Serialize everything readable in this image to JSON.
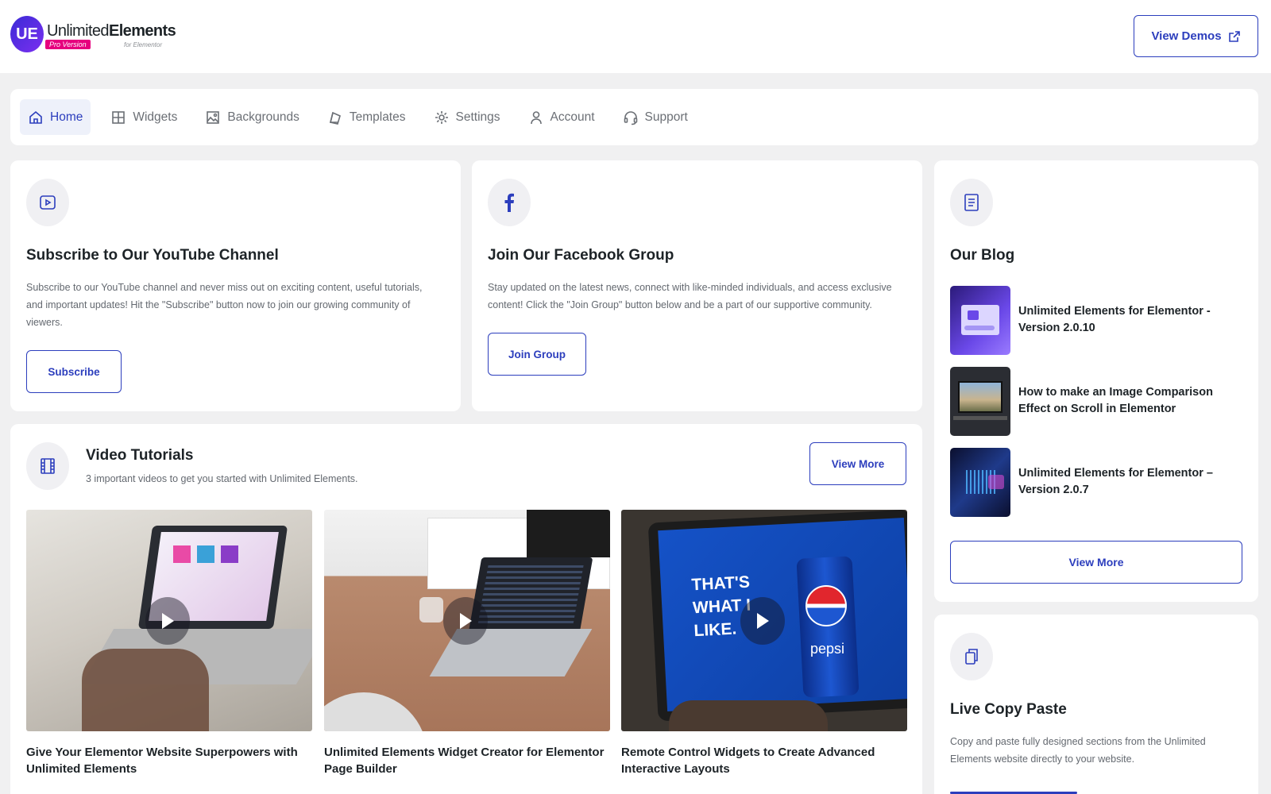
{
  "brand": {
    "mark": "UE",
    "name_thin": "Unlimited",
    "name_bold": "Elements",
    "badge": "Pro Version",
    "tagline": "for Elementor"
  },
  "header": {
    "view_demos_label": "View Demos"
  },
  "nav": {
    "items": [
      {
        "label": "Home",
        "icon": "home-icon"
      },
      {
        "label": "Widgets",
        "icon": "grid-icon"
      },
      {
        "label": "Backgrounds",
        "icon": "image-icon"
      },
      {
        "label": "Templates",
        "icon": "templates-icon"
      },
      {
        "label": "Settings",
        "icon": "gear-icon"
      },
      {
        "label": "Account",
        "icon": "user-icon"
      },
      {
        "label": "Support",
        "icon": "headset-icon"
      }
    ],
    "active": "Home"
  },
  "youtube": {
    "title": "Subscribe to Our YouTube Channel",
    "description": "Subscribe to our YouTube channel and never miss out on exciting content, useful tutorials, and important updates! Hit the \"Subscribe\" button now to join our growing community of viewers.",
    "button_label": "Subscribe"
  },
  "facebook": {
    "title": "Join Our Facebook Group",
    "description": "Stay updated on the latest news, connect with like-minded individuals, and access exclusive content! Click the \"Join Group\" button below and be a part of our supportive community.",
    "button_label": "Join Group"
  },
  "blog": {
    "title": "Our Blog",
    "posts": [
      {
        "title": "Unlimited Elements for Elementor - Version 2.0.10"
      },
      {
        "title": "How to make an Image Comparison Effect on Scroll in Elementor"
      },
      {
        "title": "Unlimited Elements for Elementor – Version 2.0.7"
      }
    ],
    "view_more_label": "View More"
  },
  "tutorials": {
    "title": "Video Tutorials",
    "subtitle": "3 important videos to get you started with Unlimited Elements.",
    "view_more_label": "View More",
    "videos": [
      {
        "title": "Give Your Elementor Website Superpowers with Unlimited Elements"
      },
      {
        "title": "Unlimited Elements Widget Creator for Elementor Page Builder"
      },
      {
        "title": "Remote Control Widgets to Create Advanced Interactive Layouts"
      }
    ],
    "thumb_texts": {
      "slogan": "THAT'S WHAT I LIKE.",
      "can_label": "pepsi"
    }
  },
  "copy_paste": {
    "title": "Live Copy Paste",
    "description": "Copy and paste fully designed sections from the Unlimited Elements website directly to your website."
  },
  "colors": {
    "accent": "#2c3ebd",
    "background": "#f0f0f1",
    "brand_pink": "#e6007e"
  }
}
